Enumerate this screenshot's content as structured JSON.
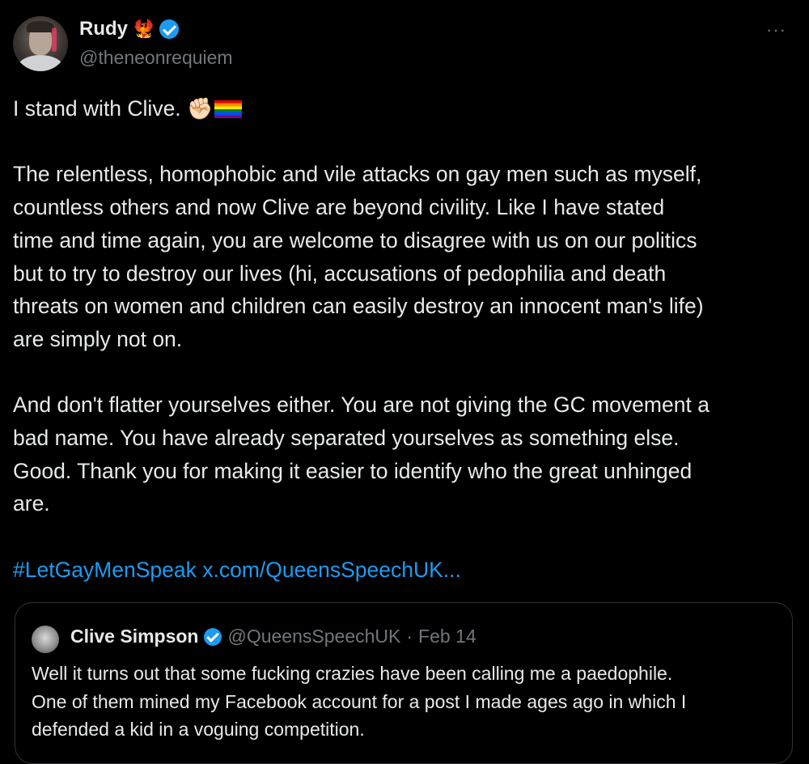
{
  "author": {
    "display_name": "Rudy",
    "name_emojis": "🐦‍🔥",
    "handle": "@theneonrequiem",
    "more_label": "···"
  },
  "tweet": {
    "line1_text": "I stand with Clive.",
    "line1_emoji": "✊🏻",
    "para2": [
      "The relentless, homophobic and vile attacks on gay men such as myself,",
      "countless others and now Clive are beyond civility. Like I have stated",
      "time and time again, you are welcome to disagree with us on our politics",
      "but to try to destroy our lives (hi, accusations of pedophilia and death",
      "threats on women and children can easily destroy an innocent man's life)",
      "are simply not on."
    ],
    "para3": [
      "And don't flatter yourselves either. You are not giving the GC movement a",
      "bad name. You have already separated yourselves as something else.",
      "Good. Thank you for making it easier to identify who the great unhinged",
      "are."
    ],
    "hashtag": "#LetGayMenSpeak",
    "link": "x.com/QueensSpeechUK..."
  },
  "quote": {
    "name": "Clive Simpson",
    "handle": "@QueensSpeechUK",
    "separator": "·",
    "date": "Feb 14",
    "lines": [
      "Well it turns out that some fucking crazies have been calling me a paedophile.",
      "One of them mined my Facebook account for a post I made ages ago in which I",
      "defended a kid in a voguing competition."
    ]
  },
  "colors": {
    "background": "#000000",
    "text": "#e7e9ea",
    "muted": "#71767b",
    "link": "#1d9bf0",
    "border": "#2f3336"
  }
}
